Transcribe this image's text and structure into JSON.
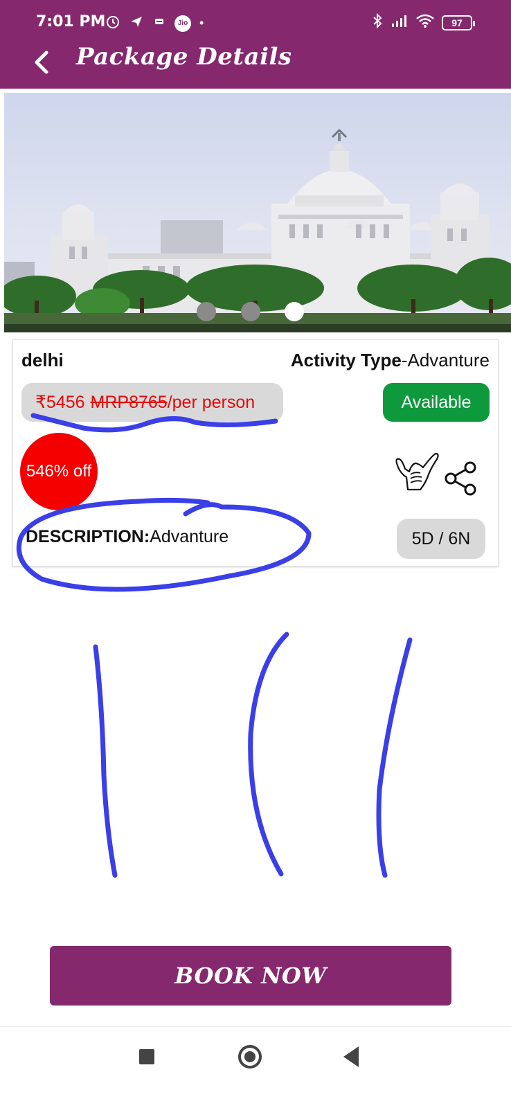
{
  "status_bar": {
    "time": "7:01 PM",
    "jio_label": "Jio",
    "battery": "97",
    "icons": [
      "alarm-icon",
      "location-icon",
      "app-icon",
      "jio-icon",
      "dot-icon",
      "bluetooth-icon",
      "signal-icon",
      "wifi-icon",
      "battery-icon"
    ]
  },
  "header": {
    "title": "Package Details",
    "back_icon": "chevron-left-icon"
  },
  "carousel": {
    "slide_count": 3,
    "active_index": 2
  },
  "package": {
    "city": "delhi",
    "activity_label": "Activity Type",
    "activity_value": "-Advanture",
    "price": "₹5456",
    "mrp": "MRP8765",
    "per_person": "/per person",
    "availability": "Available",
    "discount": "546% off",
    "description_label": "DESCRIPTION:",
    "description_value": "Advanture",
    "duration": "5D / 6N",
    "action_icons": [
      "shaka-hand-icon",
      "share-icon"
    ]
  },
  "actions": {
    "book_label": "BOOK NOW"
  },
  "colors": {
    "brand": "#86286d",
    "available": "#0e9a3c",
    "discount": "#f40000",
    "price_text": "#e30b0b",
    "annotation_ink": "#3a3fe8"
  },
  "nav": {
    "icons": [
      "recent-apps-icon",
      "home-icon",
      "back-icon"
    ]
  }
}
